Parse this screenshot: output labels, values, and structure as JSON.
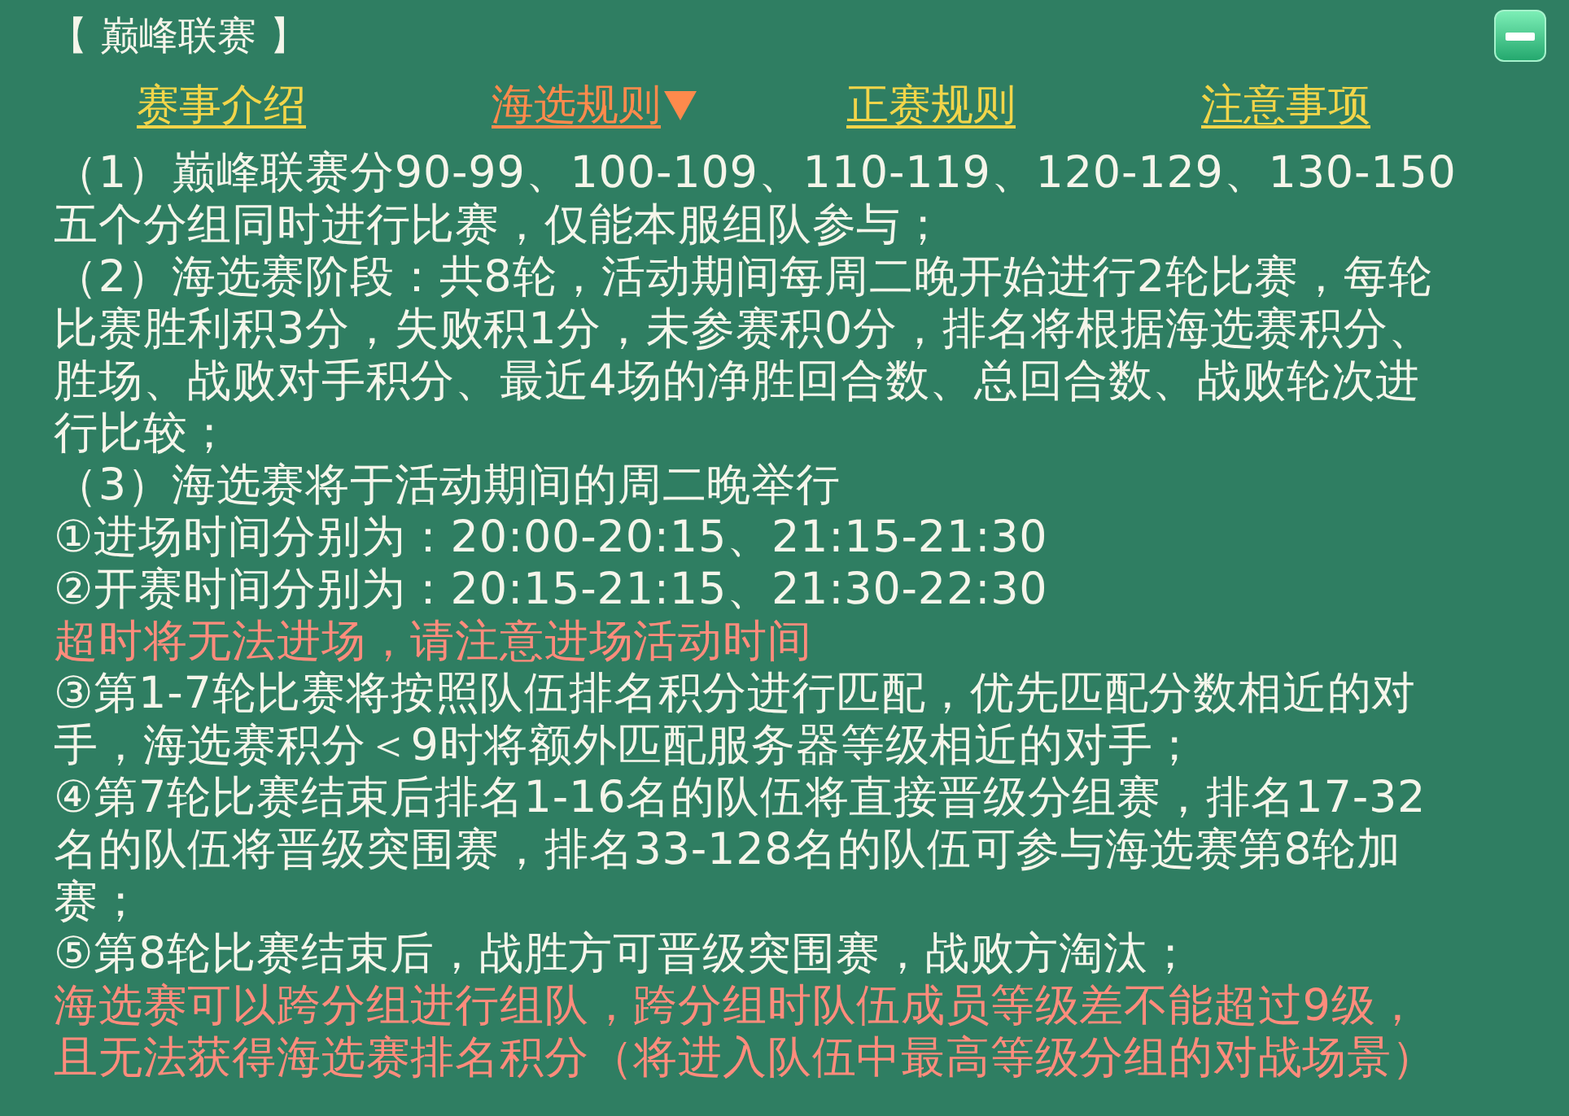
{
  "title": "【 巅峰联赛 】",
  "tabs": [
    {
      "label": "赛事介绍",
      "selected": false
    },
    {
      "label": "海选规则",
      "selected": true
    },
    {
      "label": "正赛规则",
      "selected": false
    },
    {
      "label": "注意事项",
      "selected": false
    }
  ],
  "paragraphs": [
    {
      "kind": "rule",
      "text": "（1）巅峰联赛分90-99、100-109、110-119、120-129、130-150五个分组同时进行比赛，仅能本服组队参与；"
    },
    {
      "kind": "rule",
      "text": "（2）海选赛阶段：共8轮，活动期间每周二晚开始进行2轮比赛，每轮比赛胜利积3分，失败积1分，未参赛积0分，排名将根据海选赛积分、胜场、战败对手积分、最近4场的净胜回合数、总回合数、战败轮次进行比较；"
    },
    {
      "kind": "rule",
      "text": "（3）海选赛将于活动期间的周二晚举行"
    },
    {
      "kind": "rule",
      "text": "①进场时间分别为：20:00-20:15、21:15-21:30"
    },
    {
      "kind": "rule",
      "text": "②开赛时间分别为：20:15-21:15、21:30-22:30"
    },
    {
      "kind": "warning",
      "text": "超时将无法进场，请注意进场活动时间"
    },
    {
      "kind": "rule",
      "text": "③第1-7轮比赛将按照队伍排名积分进行匹配，优先匹配分数相近的对手，海选赛积分＜9时将额外匹配服务器等级相近的对手；"
    },
    {
      "kind": "rule",
      "text": "④第7轮比赛结束后排名1-16名的队伍将直接晋级分组赛，排名17-32名的队伍将晋级突围赛，排名33-128名的队伍可参与海选赛第8轮加赛；"
    },
    {
      "kind": "rule",
      "text": "⑤第8轮比赛结束后，战胜方可晋级突围赛，战败方淘汰；"
    },
    {
      "kind": "warning",
      "text": "海选赛可以跨分组进行组队，跨分组时队伍成员等级差不能超过9级，且无法获得海选赛排名积分（将进入队伍中最高等级分组的对战场景）"
    }
  ]
}
